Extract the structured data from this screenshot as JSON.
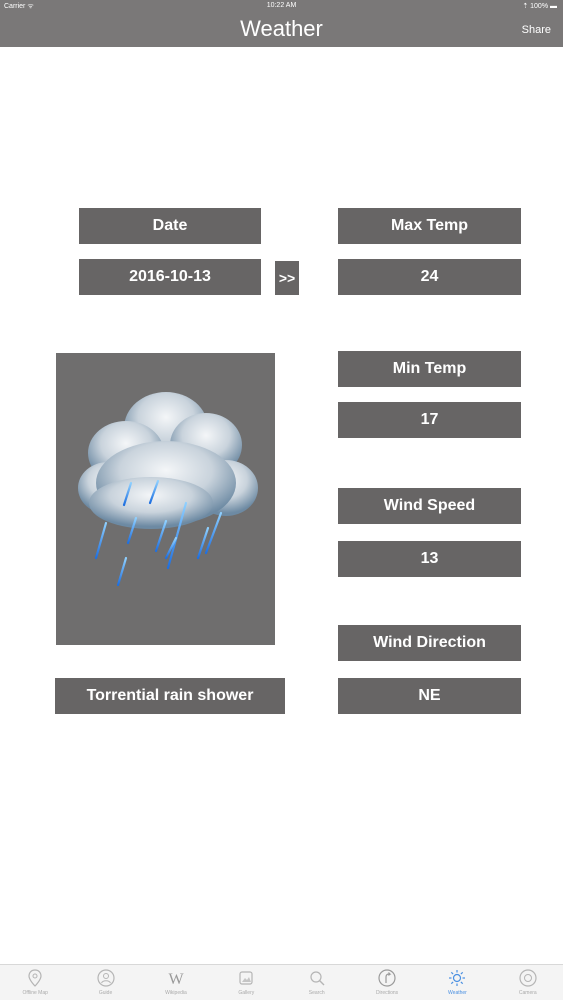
{
  "status_bar": {
    "carrier": "Carrier ᯤ",
    "time": "10:22 AM",
    "battery": "⇡ 100% ▬"
  },
  "nav": {
    "title": "Weather",
    "share_label": "Share"
  },
  "fields": {
    "date_label": "Date",
    "date_value": "2016-10-13",
    "next_label": ">>",
    "max_temp_label": "Max Temp",
    "max_temp_value": "24",
    "min_temp_label": "Min Temp",
    "min_temp_value": "17",
    "wind_speed_label": "Wind Speed",
    "wind_speed_value": "13",
    "wind_direction_label": "Wind Direction",
    "wind_direction_value": "NE",
    "condition": "Torrential rain shower"
  },
  "weather_icon": "rain-cloud-icon",
  "colors": {
    "bar": "#7a7878",
    "box": "#676565",
    "active_tab": "#4a90e2"
  },
  "tabs": [
    {
      "label": "Offline Map",
      "icon": "map-pin-icon"
    },
    {
      "label": "Guide",
      "icon": "guide-icon"
    },
    {
      "label": "Wikipedia",
      "icon": "wikipedia-icon"
    },
    {
      "label": "Gallery",
      "icon": "gallery-icon"
    },
    {
      "label": "Search",
      "icon": "search-icon"
    },
    {
      "label": "Directions",
      "icon": "directions-icon"
    },
    {
      "label": "Weather",
      "icon": "weather-sun-icon",
      "active": true
    },
    {
      "label": "Camera",
      "icon": "camera-icon"
    }
  ]
}
